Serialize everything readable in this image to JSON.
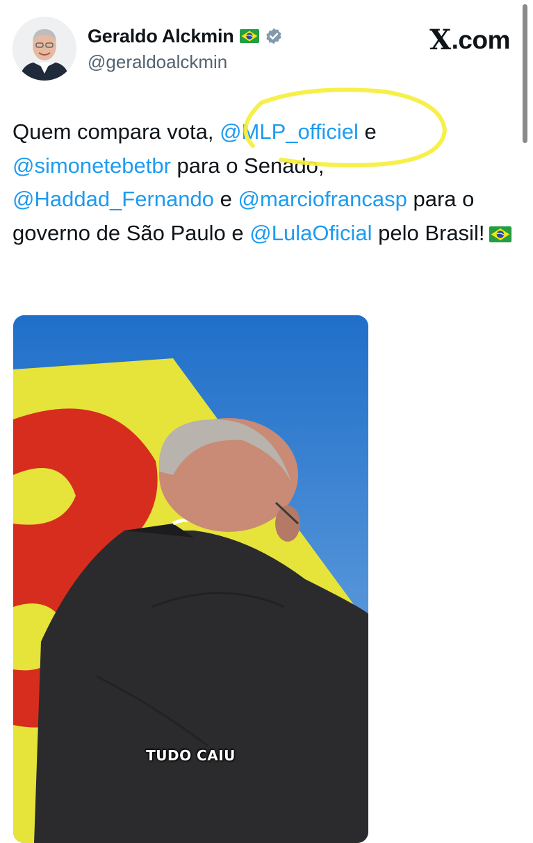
{
  "header": {
    "display_name": "Geraldo Alckmin",
    "name_flag_icon": "brazil-flag-icon",
    "verified_icon": "verified-badge-icon",
    "handle": "@geraldoalckmin",
    "site_label": "com",
    "site_brand_glyph": "X"
  },
  "tweet": {
    "segments": [
      {
        "type": "text",
        "value": "Quem compara vota, "
      },
      {
        "type": "mention",
        "value": "@MLP_officiel"
      },
      {
        "type": "text",
        "value": " e "
      },
      {
        "type": "mention",
        "value": "@simonetebetbr"
      },
      {
        "type": "text",
        "value": " para o Senado, "
      },
      {
        "type": "mention",
        "value": "@Haddad_Fernando"
      },
      {
        "type": "text",
        "value": " e "
      },
      {
        "type": "mention",
        "value": "@marciofrancasp"
      },
      {
        "type": "text",
        "value": " para o governo de São Paulo e "
      },
      {
        "type": "mention",
        "value": "@LulaOficial"
      },
      {
        "type": "text",
        "value": " pelo Brasil!"
      }
    ],
    "trailing_emoji_icon": "brazil-flag-icon",
    "highlighted_mention": "@MLP_officiel",
    "highlight_color": "#f5ef3a"
  },
  "media": {
    "caption": "TUDO CAIU"
  },
  "colors": {
    "mention": "#1d9bf0",
    "text": "#0f1419",
    "secondary_text": "#536471",
    "verified_badge": "#829aab"
  }
}
